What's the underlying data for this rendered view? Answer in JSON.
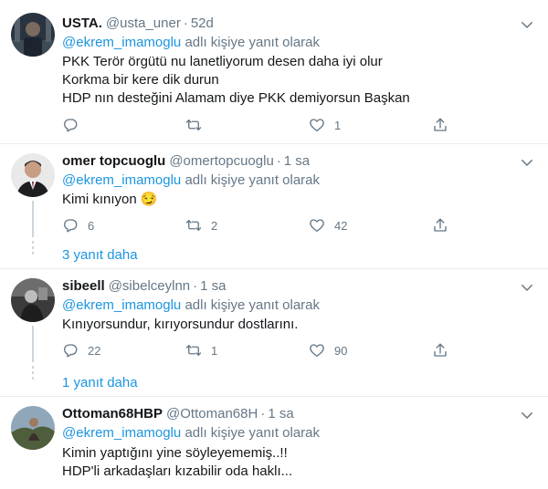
{
  "tweets": [
    {
      "name": "USTA.",
      "handle": "@usta_uner",
      "sep": "·",
      "time": "52d",
      "reply_mention": "@ekrem_imamoglu",
      "reply_suffix": " adlı kişiye yanıt olarak",
      "lines": [
        "PKK Terör örgütü nu lanetliyorum desen daha iyi olur",
        "Korkma bir kere dik durun",
        "HDP  nın desteğini Alamam diye PKK  demiyorsun Başkan"
      ],
      "replies": "",
      "retweets": "",
      "likes": "1"
    },
    {
      "name": "omer topcuoglu",
      "handle": "@omertopcuoglu",
      "sep": "·",
      "time": "1 sa",
      "reply_mention": "@ekrem_imamoglu",
      "reply_suffix": " adlı kişiye yanıt olarak",
      "lines": [
        "Kimi kınıyon 😏"
      ],
      "replies": "6",
      "retweets": "2",
      "likes": "42",
      "more_replies": "3 yanıt daha"
    },
    {
      "name": "sibeell",
      "handle": "@sibelceylnn",
      "sep": "·",
      "time": "1 sa",
      "reply_mention": "@ekrem_imamoglu",
      "reply_suffix": " adlı kişiye yanıt olarak",
      "lines": [
        "Kınıyorsundur, kırıyorsundur dostlarını."
      ],
      "replies": "22",
      "retweets": "1",
      "likes": "90",
      "more_replies": "1 yanıt daha"
    },
    {
      "name": "Ottoman68HBP",
      "handle": "@Ottoman68H",
      "sep": "·",
      "time": "1 sa",
      "reply_mention": "@ekrem_imamoglu",
      "reply_suffix": " adlı kişiye yanıt olarak",
      "lines": [
        "Kimin yaptığını yine söyleyememiş..!!",
        "HDP'li arkadaşları kızabilir oda haklı..."
      ]
    }
  ],
  "icons": {
    "reply": "reply-icon",
    "retweet": "retweet-icon",
    "like": "like-icon",
    "share": "share-icon",
    "menu": "chevron-down-icon"
  },
  "colors": {
    "link": "#1b95e0",
    "muted": "#657786",
    "text": "#14171a",
    "divider": "#e6ecf0"
  }
}
